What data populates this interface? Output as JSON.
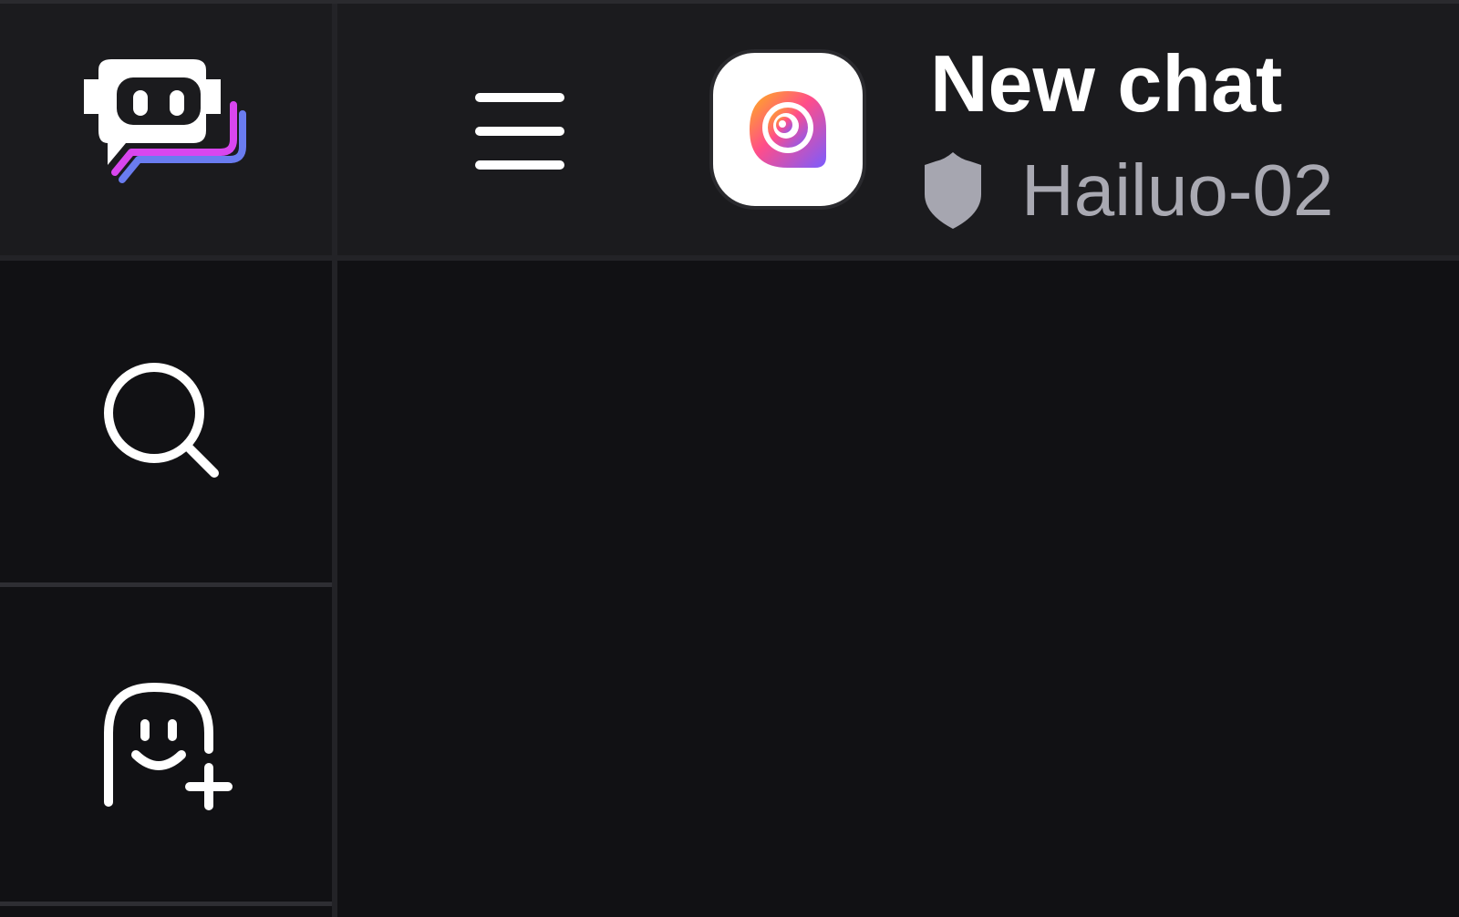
{
  "header": {
    "title": "New chat",
    "bot_name": "Hailuo-02"
  },
  "icons": {
    "logo": "poe-robot-logo",
    "search": "search-icon",
    "create_bot": "create-bot-icon",
    "menu": "hamburger-menu-icon",
    "bot_avatar": "hailuo-swirl-icon",
    "badge": "shield-icon"
  },
  "colors": {
    "background": "#111114",
    "panel": "#1b1b1e",
    "text_primary": "#ffffff",
    "text_secondary": "#a9a9b2",
    "shield": "#a6a6b0",
    "logo_magenta": "#d946ef",
    "logo_blue": "#6a7cf0"
  }
}
